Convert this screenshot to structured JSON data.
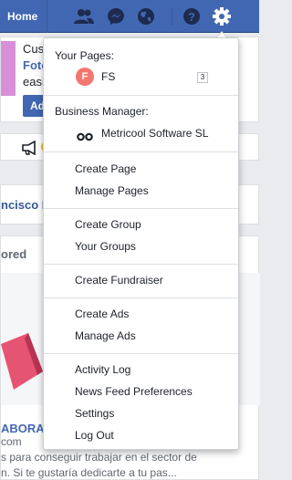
{
  "topbar": {
    "home_label": "Home",
    "icons": [
      "friend-requests-icon",
      "messenger-icon",
      "notifications-globe-icon",
      "help-icon",
      "settings-gear-icon"
    ]
  },
  "background": {
    "promo_lines": [
      "Cus",
      "Foto",
      "easi"
    ],
    "promo_button_label": "Ad",
    "name_fragment": "ncisco F",
    "sponsored_fragment": "ored",
    "ad_title_fragment": "ABORA",
    "ad_domain_fragment": "com",
    "ad_text_line1": "s para conseguir trabajar en el sector de",
    "ad_text_line2": "n. Si te gustaría dedicarte a tu pas..."
  },
  "menu": {
    "your_pages_heading": "Your Pages:",
    "page_initial": "F",
    "page_name": "FS",
    "page_badge": "3",
    "business_heading": "Business Manager:",
    "business_name": "Metricool Software SL",
    "items_group1": [
      "Create Page",
      "Manage Pages"
    ],
    "items_group2": [
      "Create Group",
      "Your Groups"
    ],
    "items_group3": [
      "Create Fundraiser"
    ],
    "items_group4": [
      "Create Ads",
      "Manage Ads"
    ],
    "items_group5": [
      "Activity Log",
      "News Feed Preferences",
      "Settings",
      "Log Out"
    ]
  },
  "colors": {
    "topbar": "#4267b2",
    "promo_accent": "#d98fd8",
    "button": "#4267b2",
    "avatar": "#f3776f"
  }
}
